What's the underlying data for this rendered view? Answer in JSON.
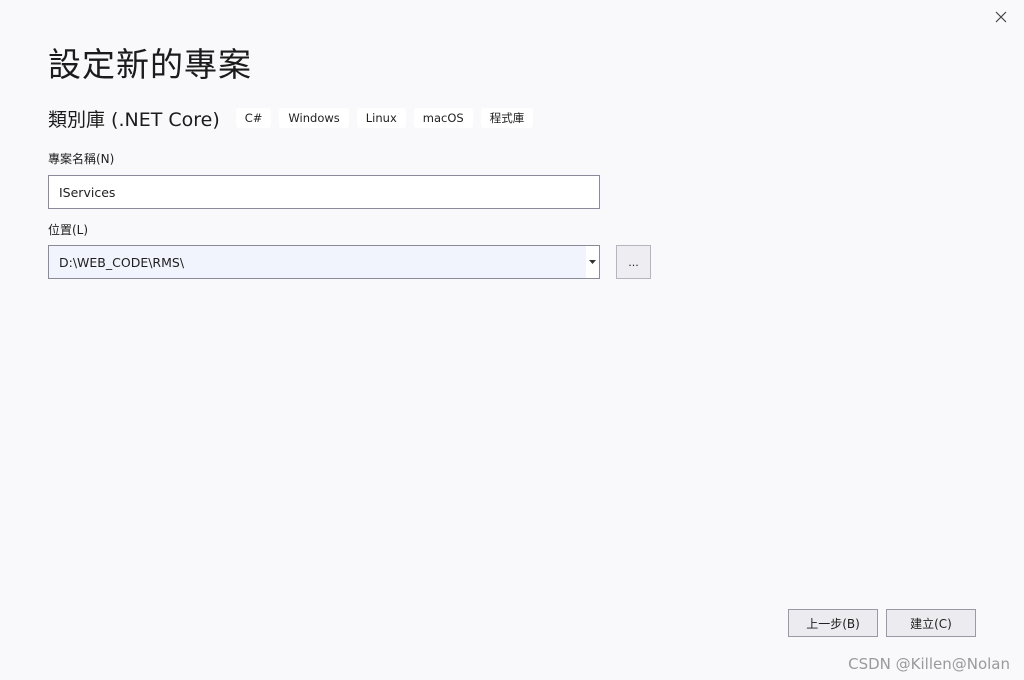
{
  "window": {
    "title": "設定新的專案",
    "close_icon": "close-icon"
  },
  "template": {
    "name": "類別庫 (.NET Core)",
    "tags": [
      "C#",
      "Windows",
      "Linux",
      "macOS",
      "程式庫"
    ]
  },
  "project_name": {
    "label": "專案名稱(N)",
    "value": "IServices"
  },
  "location": {
    "label": "位置(L)",
    "value": "D:\\WEB_CODE\\RMS\\",
    "dropdown_icon": "caret-down-icon",
    "browse_label": "..."
  },
  "footer": {
    "back_label": "上一步(B)",
    "create_label": "建立(C)"
  },
  "watermark": "CSDN @Killen@Nolan"
}
